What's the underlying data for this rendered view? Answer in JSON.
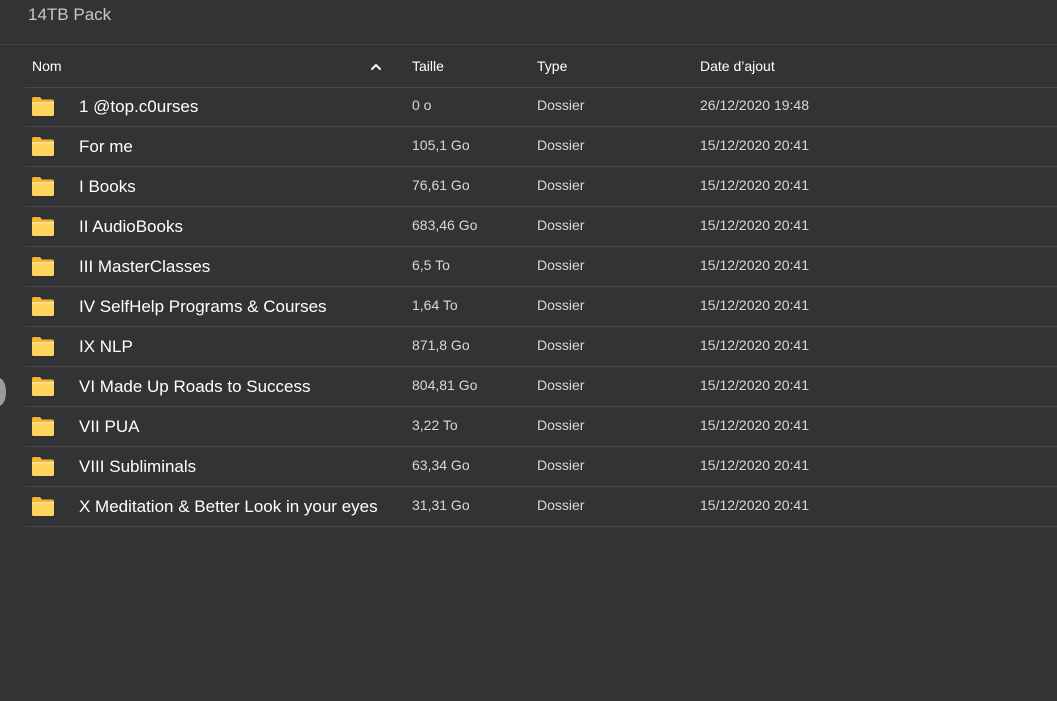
{
  "window": {
    "folder_title": "14TB Pack"
  },
  "table": {
    "columns": {
      "name": "Nom",
      "size": "Taille",
      "type": "Type",
      "date": "Date d’ajout"
    },
    "sort": {
      "column": "name",
      "direction": "ascending",
      "icon": "chevron-up-icon"
    },
    "rows": [
      {
        "name": "1 @top.c0urses",
        "size": "0 o",
        "type": "Dossier",
        "date": "26/12/2020 19:48"
      },
      {
        "name": "For me",
        "size": "105,1 Go",
        "type": "Dossier",
        "date": "15/12/2020 20:41"
      },
      {
        "name": "I Books",
        "size": "76,61 Go",
        "type": "Dossier",
        "date": "15/12/2020 20:41"
      },
      {
        "name": "II AudioBooks",
        "size": "683,46 Go",
        "type": "Dossier",
        "date": "15/12/2020 20:41"
      },
      {
        "name": "III MasterClasses",
        "size": "6,5 To",
        "type": "Dossier",
        "date": "15/12/2020 20:41"
      },
      {
        "name": "IV SelfHelp Programs & Courses",
        "size": "1,64 To",
        "type": "Dossier",
        "date": "15/12/2020 20:41"
      },
      {
        "name": "IX NLP",
        "size": "871,8 Go",
        "type": "Dossier",
        "date": "15/12/2020 20:41"
      },
      {
        "name": "VI Made Up Roads to Success",
        "size": "804,81 Go",
        "type": "Dossier",
        "date": "15/12/2020 20:41"
      },
      {
        "name": "VII PUA",
        "size": "3,22 To",
        "type": "Dossier",
        "date": "15/12/2020 20:41"
      },
      {
        "name": "VIII Subliminals",
        "size": "63,34 Go",
        "type": "Dossier",
        "date": "15/12/2020 20:41"
      },
      {
        "name": "X Meditation & Better Look in your eyes",
        "size": "31,31 Go",
        "type": "Dossier",
        "date": "15/12/2020 20:41"
      }
    ],
    "row_icon": "folder-icon"
  },
  "colors": {
    "background": "#333333",
    "divider": "#484848",
    "folder_body": "#ffd45e",
    "folder_tab": "#f2b635"
  }
}
